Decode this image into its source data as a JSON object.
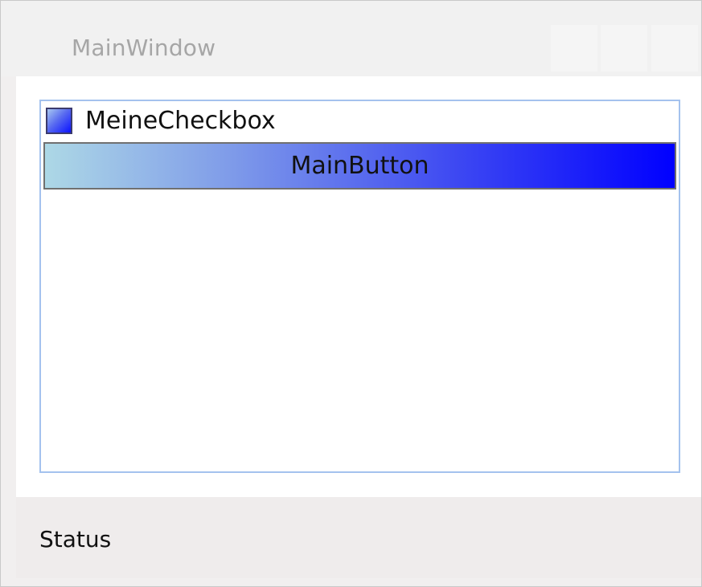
{
  "window": {
    "title": "MainWindow"
  },
  "list": {
    "checkbox_label": "MeineCheckbox",
    "button_label": "MainButton"
  },
  "status": {
    "text": "Status"
  },
  "colors": {
    "listbox_border": "#a4c2ee",
    "button_gradient_start": "#add8e6",
    "button_gradient_end": "#0000ff"
  }
}
